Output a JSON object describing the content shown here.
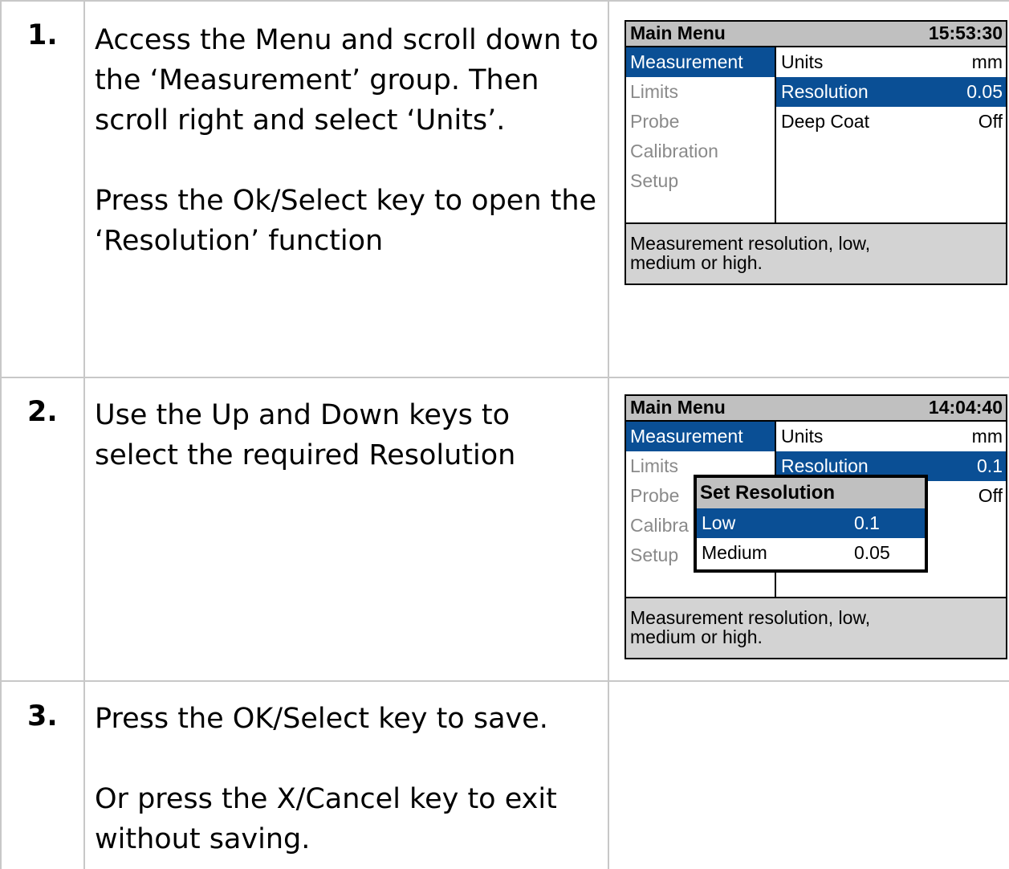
{
  "steps": [
    {
      "number": "1.",
      "paragraphs": [
        "Access the Menu and scroll down to the ‘Measurement’ group. Then scroll right and select ‘Units’.",
        "Press the Ok/Select key to open the ‘Resolution’ function"
      ]
    },
    {
      "number": "2.",
      "paragraphs": [
        "Use the Up and Down keys to select the required Resolution"
      ]
    },
    {
      "number": "3.",
      "paragraphs": [
        "Press the OK/Select key to save.",
        "Or press the X/Cancel key to exit without saving."
      ]
    }
  ],
  "screen1": {
    "title": "Main Menu",
    "clock": "15:53:30",
    "left_items": [
      "Measurement",
      "Limits",
      "Probe",
      "Calibration",
      "Setup"
    ],
    "right_items": [
      {
        "label": "Units",
        "value": "mm"
      },
      {
        "label": "Resolution",
        "value": "0.05"
      },
      {
        "label": "Deep Coat",
        "value": "Off"
      }
    ],
    "help_line1": "Measurement resolution, low,",
    "help_line2": "medium or high."
  },
  "screen2": {
    "title": "Main Menu",
    "clock": "14:04:40",
    "left_items": [
      "Measurement",
      "Limits",
      "Probe",
      "Calibra",
      "Setup"
    ],
    "right_items": [
      {
        "label": "Units",
        "value": "mm"
      },
      {
        "label": "Resolution",
        "value": "0.1"
      },
      {
        "label": "",
        "value": "Off"
      }
    ],
    "popup": {
      "title": "Set Resolution",
      "options": [
        {
          "label": "Low",
          "value": "0.1"
        },
        {
          "label": "Medium",
          "value": "0.05"
        }
      ]
    },
    "help_line1": "Measurement resolution, low,",
    "help_line2": "medium or high."
  },
  "colors": {
    "selection": "#0a4f95",
    "title_bar": "#c0c0c0",
    "help_bar": "#d3d3d3",
    "inactive_text": "#8a8a8a",
    "grid_line": "#c8c8c8"
  }
}
